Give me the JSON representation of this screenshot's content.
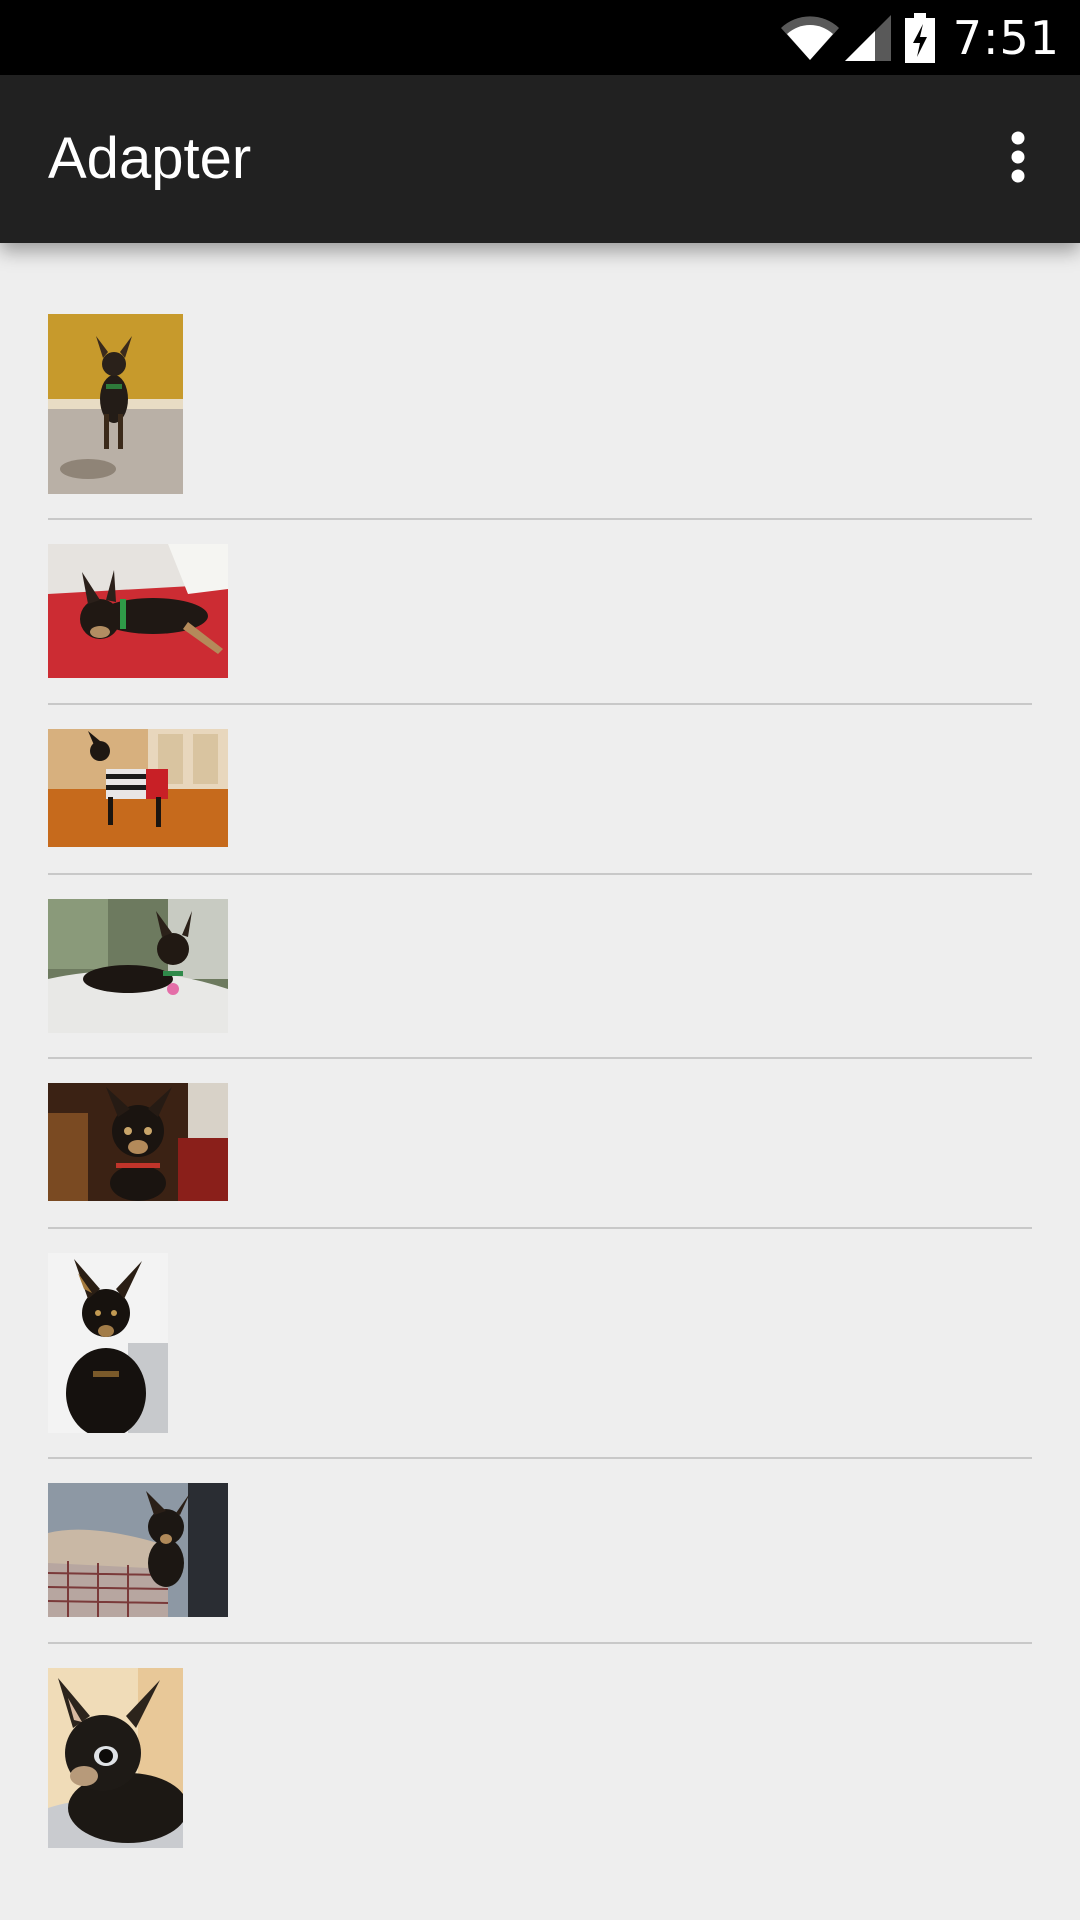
{
  "status_bar": {
    "time": "7:51",
    "icons": [
      "wifi-icon",
      "cell-signal-icon",
      "battery-charging-icon"
    ]
  },
  "action_bar": {
    "title": "Adapter",
    "menu_icon": "overflow-menu-icon"
  },
  "list": {
    "items": [
      {
        "image": "dog-photo-1"
      },
      {
        "image": "dog-photo-2"
      },
      {
        "image": "dog-photo-3"
      },
      {
        "image": "dog-photo-4"
      },
      {
        "image": "dog-photo-5"
      },
      {
        "image": "dog-photo-6"
      },
      {
        "image": "dog-photo-7"
      },
      {
        "image": "dog-photo-8"
      }
    ]
  },
  "colors": {
    "status_bar_bg": "#000000",
    "action_bar_bg": "#212121",
    "list_bg": "#eeeeee",
    "divider": "#c8c8c8"
  }
}
